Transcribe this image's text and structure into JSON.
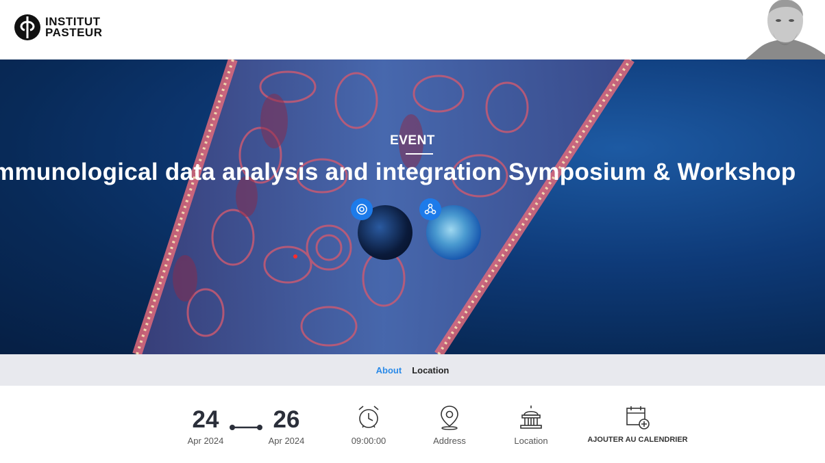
{
  "header": {
    "logo_line1": "INSTITUT",
    "logo_line2": "PASTEUR"
  },
  "hero": {
    "kicker": "EVENT",
    "title": "Immunological data analysis and integration Symposium & Workshop"
  },
  "tabs": [
    {
      "label": "About",
      "active": true
    },
    {
      "label": "Location",
      "active": false
    }
  ],
  "event": {
    "start_day": "24",
    "start_month": "Apr 2024",
    "end_day": "26",
    "end_month": "Apr 2024",
    "time": "09:00:00",
    "address_label": "Address",
    "location_label": "Location",
    "calendar_label": "AJOUTER AU CALENDRIER"
  },
  "icons": {
    "clock": "alarm-clock-icon",
    "address": "map-pin-icon",
    "location": "building-icon",
    "calendar": "calendar-add-icon"
  },
  "colors": {
    "accent": "#2a8ae8",
    "tab_bar": "#e8e9ee",
    "hero_bg": "#0e3a78",
    "text_dark": "#2b2f3a"
  }
}
